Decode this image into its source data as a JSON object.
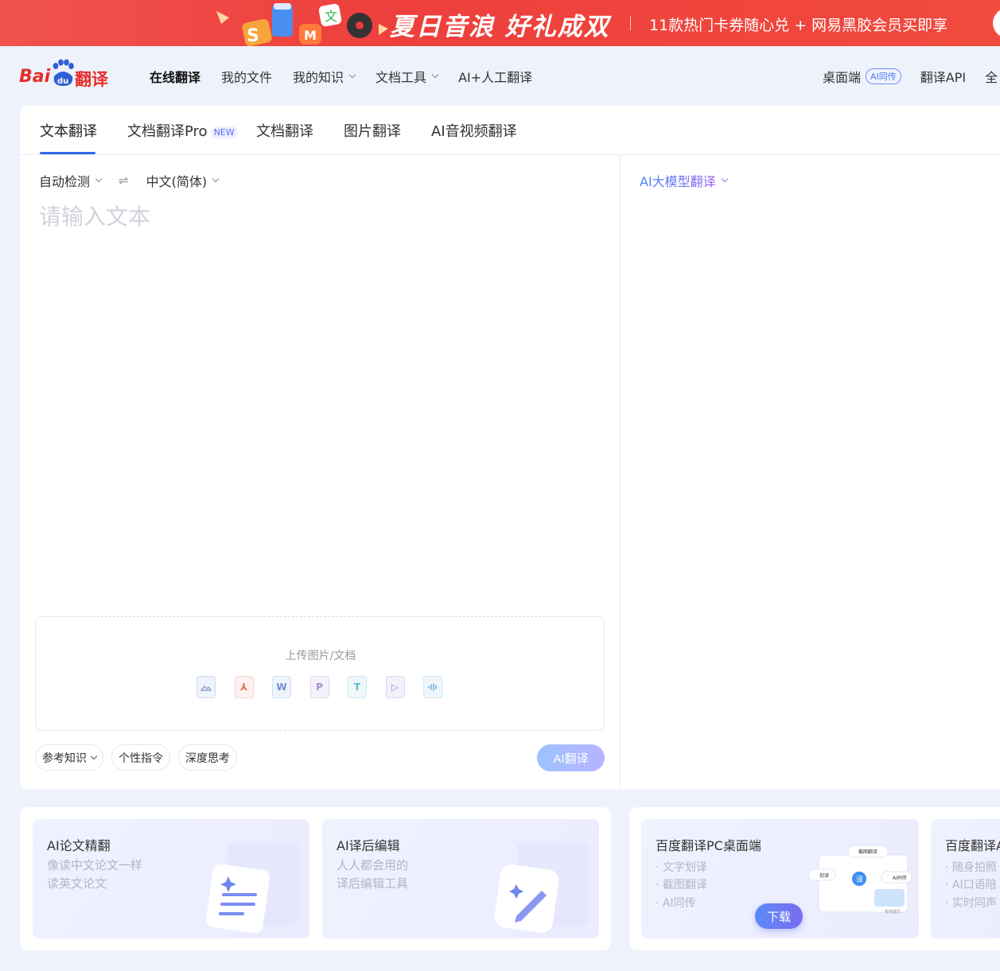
{
  "banner": {
    "headline": "夏日音浪  好礼成双",
    "sub": "11款热门卡券随心兑 + 网易黑胶会员买即享"
  },
  "logo": {
    "bai": "Bai",
    "du": "du",
    "fanyi": "翻译"
  },
  "nav": {
    "items": [
      {
        "label": "在线翻译",
        "dropdown": false
      },
      {
        "label": "我的文件",
        "dropdown": false
      },
      {
        "label": "我的知识",
        "dropdown": true
      },
      {
        "label": "文档工具",
        "dropdown": true
      },
      {
        "label": "AI+人工翻译",
        "dropdown": false
      }
    ],
    "desktop": "桌面端",
    "desktop_badge": "AI同传",
    "api": "翻译API",
    "cut": "全"
  },
  "tabs": [
    {
      "label": "文本翻译"
    },
    {
      "label": "文档翻译Pro",
      "badge": "NEW"
    },
    {
      "label": "文档翻译"
    },
    {
      "label": "图片翻译"
    },
    {
      "label": "AI音视频翻译"
    }
  ],
  "source": {
    "from_lang": "自动检测",
    "to_lang": "中文(简体)",
    "placeholder": "请输入文本",
    "upload_label": "上传图片/文档",
    "chips": [
      "参考知识",
      "个性指令",
      "深度思考"
    ],
    "translate_button": "AI翻译"
  },
  "target": {
    "model": "AI大模型翻译"
  },
  "promos": [
    {
      "title": "AI论文精翻",
      "lines": [
        "像读中文论文一样",
        "读英文论文"
      ]
    },
    {
      "title": "AI译后编辑",
      "lines": [
        "人人都会用的",
        "译后编辑工具"
      ]
    },
    {
      "title": "百度翻译PC桌面端",
      "bullets": [
        "文字划译",
        "截图翻译",
        "AI同传"
      ],
      "button": "下载",
      "illus": {
        "a": "截图翻译",
        "b": "划译",
        "c": "AI同传",
        "d": "极简模式"
      }
    },
    {
      "title": "百度翻译A",
      "bullets": [
        "随身拍照",
        "AI口语陪",
        "实时同声"
      ]
    }
  ],
  "colors": {
    "brand_red": "#e52e28",
    "accent_blue": "#2f6ae6",
    "banner_red": "#ee3f3c"
  }
}
